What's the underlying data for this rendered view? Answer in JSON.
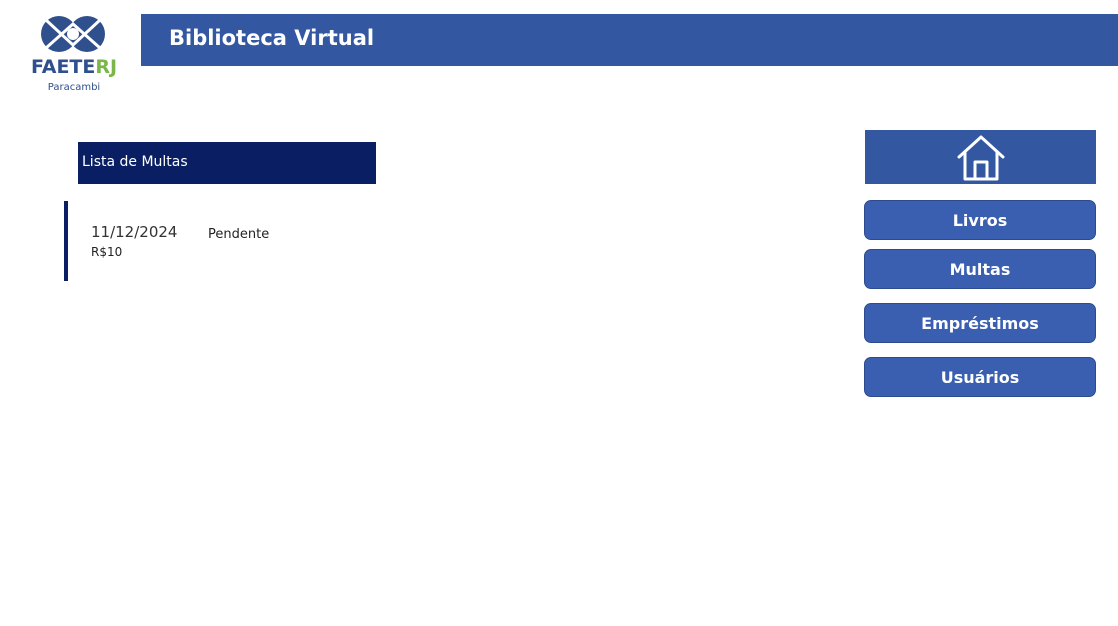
{
  "logo": {
    "brand_main": "FAETE",
    "brand_accent": "RJ",
    "subtitle": "Paracambi",
    "icon": "interlocking-circles-logo"
  },
  "header": {
    "title": "Biblioteca Virtual"
  },
  "list": {
    "title": "Lista de Multas",
    "items": [
      {
        "date": "11/12/2024",
        "amount": "R$10",
        "status": "Pendente"
      }
    ]
  },
  "nav": {
    "home_icon": "home-icon",
    "buttons": [
      {
        "label": "Livros"
      },
      {
        "label": "Multas"
      },
      {
        "label": "Empréstimos"
      },
      {
        "label": "Usuários"
      }
    ]
  },
  "colors": {
    "header": "#3457a2",
    "list_header": "#0a1f63",
    "button": "#3a5fb0",
    "logo_blue": "#2f4f8d",
    "logo_green": "#7ab648"
  }
}
